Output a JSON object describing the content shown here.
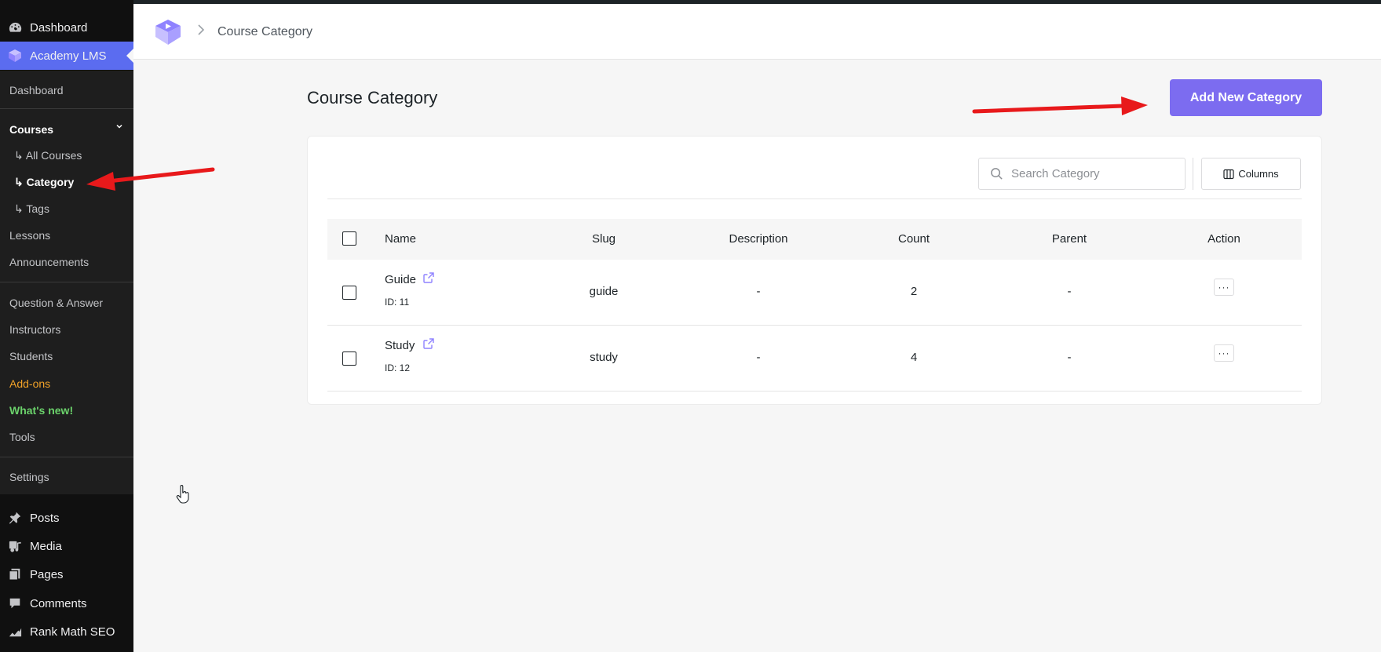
{
  "sidebar": {
    "top": [
      {
        "label": "Dashboard",
        "icon": "dashboard-icon"
      },
      {
        "label": "Academy LMS",
        "icon": "academy-logo-icon"
      }
    ],
    "submenu": {
      "dashboard": "Dashboard",
      "courses": "Courses",
      "all_courses": "↳ All Courses",
      "category": "↳ Category",
      "tags": "↳ Tags",
      "lessons": "Lessons",
      "announcements": "Announcements",
      "qa": "Question & Answer",
      "instructors": "Instructors",
      "students": "Students",
      "addons": "Add-ons",
      "whats_new": "What's new!",
      "tools": "Tools",
      "settings": "Settings"
    },
    "bottom": [
      {
        "label": "Posts",
        "icon": "pin-icon"
      },
      {
        "label": "Media",
        "icon": "media-icon"
      },
      {
        "label": "Pages",
        "icon": "pages-icon"
      },
      {
        "label": "Comments",
        "icon": "comment-icon"
      },
      {
        "label": "Rank Math SEO",
        "icon": "rank-math-icon"
      }
    ]
  },
  "header": {
    "breadcrumb": "Course Category"
  },
  "main": {
    "title": "Course Category",
    "add_button": "Add New Category",
    "search_placeholder": "Search Category",
    "columns_button": "Columns",
    "table": {
      "headers": [
        "Name",
        "Slug",
        "Description",
        "Count",
        "Parent",
        "Action"
      ],
      "rows": [
        {
          "name": "Guide",
          "id": "ID: 11",
          "slug": "guide",
          "description": "-",
          "count": "2",
          "parent": "-"
        },
        {
          "name": "Study",
          "id": "ID: 12",
          "slug": "study",
          "description": "-",
          "count": "4",
          "parent": "-"
        }
      ],
      "action_label": "···"
    }
  },
  "colors": {
    "accent": "#7c6cf0",
    "sidebar_active": "#5b6cf0",
    "sidebar_bg": "#101010",
    "submenu_bg": "#1e1e1e",
    "addons": "#f2a228",
    "whats_new": "#6bd26b",
    "annotation_arrow": "#e8191b"
  }
}
